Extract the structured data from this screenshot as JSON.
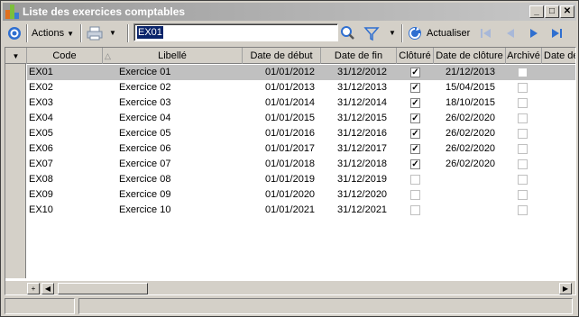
{
  "window": {
    "title": "Liste des exercices comptables",
    "minimize": "_",
    "maximize": "□",
    "close": "✕"
  },
  "toolbar": {
    "actions_label": "Actions",
    "search_value": "EX01",
    "refresh_label": "Actualiser"
  },
  "grid": {
    "columns": [
      "Code",
      "Libellé",
      "Date de début",
      "Date de fin",
      "Clôturé",
      "Date de clôture",
      "Archivé",
      "Date de"
    ],
    "rows": [
      {
        "code": "EX01",
        "libelle": "Exercice 01",
        "debut": "01/01/2012",
        "fin": "31/12/2012",
        "cloture": true,
        "date_cloture": "21/12/2013",
        "archive": false
      },
      {
        "code": "EX02",
        "libelle": "Exercice 02",
        "debut": "01/01/2013",
        "fin": "31/12/2013",
        "cloture": true,
        "date_cloture": "15/04/2015",
        "archive": false
      },
      {
        "code": "EX03",
        "libelle": "Exercice 03",
        "debut": "01/01/2014",
        "fin": "31/12/2014",
        "cloture": true,
        "date_cloture": "18/10/2015",
        "archive": false
      },
      {
        "code": "EX04",
        "libelle": "Exercice 04",
        "debut": "01/01/2015",
        "fin": "31/12/2015",
        "cloture": true,
        "date_cloture": "26/02/2020",
        "archive": false
      },
      {
        "code": "EX05",
        "libelle": "Exercice 05",
        "debut": "01/01/2016",
        "fin": "31/12/2016",
        "cloture": true,
        "date_cloture": "26/02/2020",
        "archive": false
      },
      {
        "code": "EX06",
        "libelle": "Exercice 06",
        "debut": "01/01/2017",
        "fin": "31/12/2017",
        "cloture": true,
        "date_cloture": "26/02/2020",
        "archive": false
      },
      {
        "code": "EX07",
        "libelle": "Exercice 07",
        "debut": "01/01/2018",
        "fin": "31/12/2018",
        "cloture": true,
        "date_cloture": "26/02/2020",
        "archive": false
      },
      {
        "code": "EX08",
        "libelle": "Exercice 08",
        "debut": "01/01/2019",
        "fin": "31/12/2019",
        "cloture": false,
        "date_cloture": "",
        "archive": false
      },
      {
        "code": "EX09",
        "libelle": "Exercice 09",
        "debut": "01/01/2020",
        "fin": "31/12/2020",
        "cloture": false,
        "date_cloture": "",
        "archive": false
      },
      {
        "code": "EX10",
        "libelle": "Exercice 10",
        "debut": "01/01/2021",
        "fin": "31/12/2021",
        "cloture": false,
        "date_cloture": "",
        "archive": false
      }
    ],
    "selected_row": 0
  },
  "scrollbar": {
    "add": "+",
    "left": "◀",
    "right": "▶"
  },
  "icons": {
    "nav_icon": "circle-target-icon",
    "print_icon": "printer-icon",
    "search_icon": "magnifier-icon",
    "filter_icon": "funnel-icon",
    "refresh_icon": "refresh-icon",
    "first_icon": "first-page-icon",
    "prev_icon": "previous-page-icon",
    "next_icon": "next-page-icon",
    "last_icon": "last-page-icon"
  },
  "colors": {
    "accent_blue": "#2f6fd0",
    "selection": "#0a246a"
  }
}
